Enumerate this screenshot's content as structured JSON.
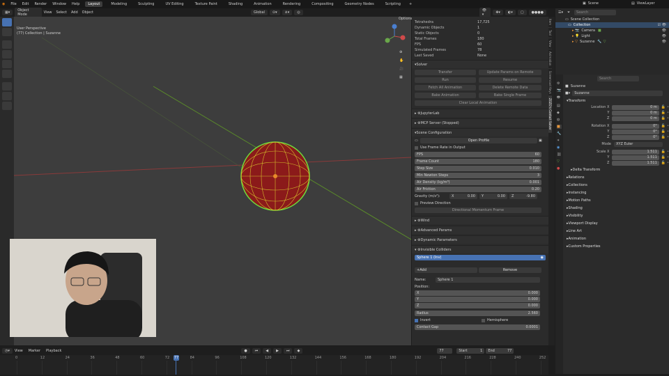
{
  "topbar": {
    "menus": [
      "File",
      "Edit",
      "Render",
      "Window",
      "Help"
    ],
    "workspaces": [
      "Layout",
      "Modeling",
      "Sculpting",
      "UV Editing",
      "Texture Paint",
      "Shading",
      "Animation",
      "Rendering",
      "Compositing",
      "Geometry Nodes",
      "Scripting"
    ],
    "active_workspace": "Layout",
    "scene": "Scene",
    "view_layer": "ViewLayer"
  },
  "viewport_header": {
    "mode": "Object Mode",
    "menus": [
      "View",
      "Select",
      "Add",
      "Object"
    ],
    "orientation": "Global",
    "options": "Options"
  },
  "viewport": {
    "perspective": "User Perspective",
    "collection": "(77) Collection | Suzanne"
  },
  "npanel": {
    "stats": [
      {
        "k": "Tetrahedra",
        "v": "17,725"
      },
      {
        "k": "Dynamic Objects",
        "v": "1"
      },
      {
        "k": "Static Objects",
        "v": "0"
      },
      {
        "k": "Total Frames",
        "v": "180"
      },
      {
        "k": "FPS",
        "v": "60"
      },
      {
        "k": "Simulated Frames",
        "v": "78"
      },
      {
        "k": "Last Saved",
        "v": "None"
      }
    ],
    "solver_title": "Solver",
    "solver_buttons": [
      [
        "Transfer",
        "Update Params on Remote"
      ],
      [
        "Run",
        "Resume"
      ],
      [
        "Fetch All Animation",
        "Delete Remote Data"
      ],
      [
        "Bake Animation",
        "Bake Single Frame"
      ]
    ],
    "clear_local": "Clear Local Animation",
    "jupyter": "JupyterLab",
    "mcp": "MCP Server (Stopped)",
    "scene_config_title": "Scene Configuration",
    "open_profile": "Open Profile",
    "use_frame_rate": "Use Frame Rate in Output",
    "config_fields": [
      {
        "k": "FPS",
        "v": "60"
      },
      {
        "k": "Frame Count",
        "v": "180"
      },
      {
        "k": "Step Size",
        "v": "0.010"
      },
      {
        "k": "Min Newton Steps",
        "v": "3"
      },
      {
        "k": "Air Density (kg/m³)",
        "v": "0.001"
      },
      {
        "k": "Air Friction",
        "v": "0.20"
      }
    ],
    "gravity_label": "Gravity (m/s²):",
    "gravity": {
      "x": "0.00",
      "y": "0.00",
      "z": "-9.80"
    },
    "preview_direction": "Preview Direction",
    "directional_momentum": "Directional Momentum Frame",
    "panels": [
      "Wind",
      "Advanced Params",
      "Dynamic Parameters",
      "Invisible Colliders"
    ],
    "collider_item": "Sphere 1 (Inv)",
    "add": "Add",
    "remove": "Remove",
    "name_label": "Name:",
    "name_value": "Sphere 1",
    "position_label": "Position:",
    "position": [
      {
        "k": "X",
        "v": "0.000"
      },
      {
        "k": "Y",
        "v": "0.000"
      },
      {
        "k": "Z",
        "v": "0.000"
      }
    ],
    "radius_label": "Radius",
    "radius": "2.560",
    "invert": "Invert",
    "hemisphere": "Hemisphere",
    "contact_gap": "Contact Gap",
    "contact_gap_value": "0.0001"
  },
  "ntabs": [
    "Item",
    "Tool",
    "View",
    "Animation",
    "Screencast Keys",
    "ZOZO's Contact Solver"
  ],
  "outliner": {
    "search_placeholder": "Search",
    "root": "Scene Collection",
    "collection": "Collection",
    "items": [
      "Camera",
      "Light",
      "Suzanne"
    ]
  },
  "properties": {
    "search_placeholder": "Search",
    "object_name": "Suzanne",
    "object_name2": "Suzanne",
    "transform": "Transform",
    "location": [
      {
        "k": "Location X",
        "v": "0 m"
      },
      {
        "k": "Y",
        "v": "0 m"
      },
      {
        "k": "Z",
        "v": "0 m"
      }
    ],
    "rotation": [
      {
        "k": "Rotation X",
        "v": "0°"
      },
      {
        "k": "Y",
        "v": "0°"
      },
      {
        "k": "Z",
        "v": "0°"
      }
    ],
    "mode_label": "Mode",
    "mode_value": "XYZ Euler",
    "scale": [
      {
        "k": "Scale X",
        "v": "1.511"
      },
      {
        "k": "Y",
        "v": "1.511"
      },
      {
        "k": "Z",
        "v": "1.511"
      }
    ],
    "delta": "Delta Transform",
    "sections": [
      "Relations",
      "Collections",
      "Instancing",
      "Motion Paths",
      "Shading",
      "Visibility",
      "Viewport Display",
      "Line Art",
      "Animation",
      "Custom Properties"
    ]
  },
  "timeline": {
    "menus": [
      "View",
      "Marker",
      "Playback"
    ],
    "current_frame": "77",
    "start_label": "Start",
    "start": "1",
    "end_label": "End",
    "end": "77",
    "ticks": [
      "0",
      "12",
      "24",
      "36",
      "48",
      "60",
      "72",
      "84",
      "96",
      "108",
      "120",
      "132",
      "144",
      "156",
      "168",
      "180",
      "192",
      "204",
      "216",
      "228",
      "240",
      "252"
    ],
    "playhead": "77"
  }
}
